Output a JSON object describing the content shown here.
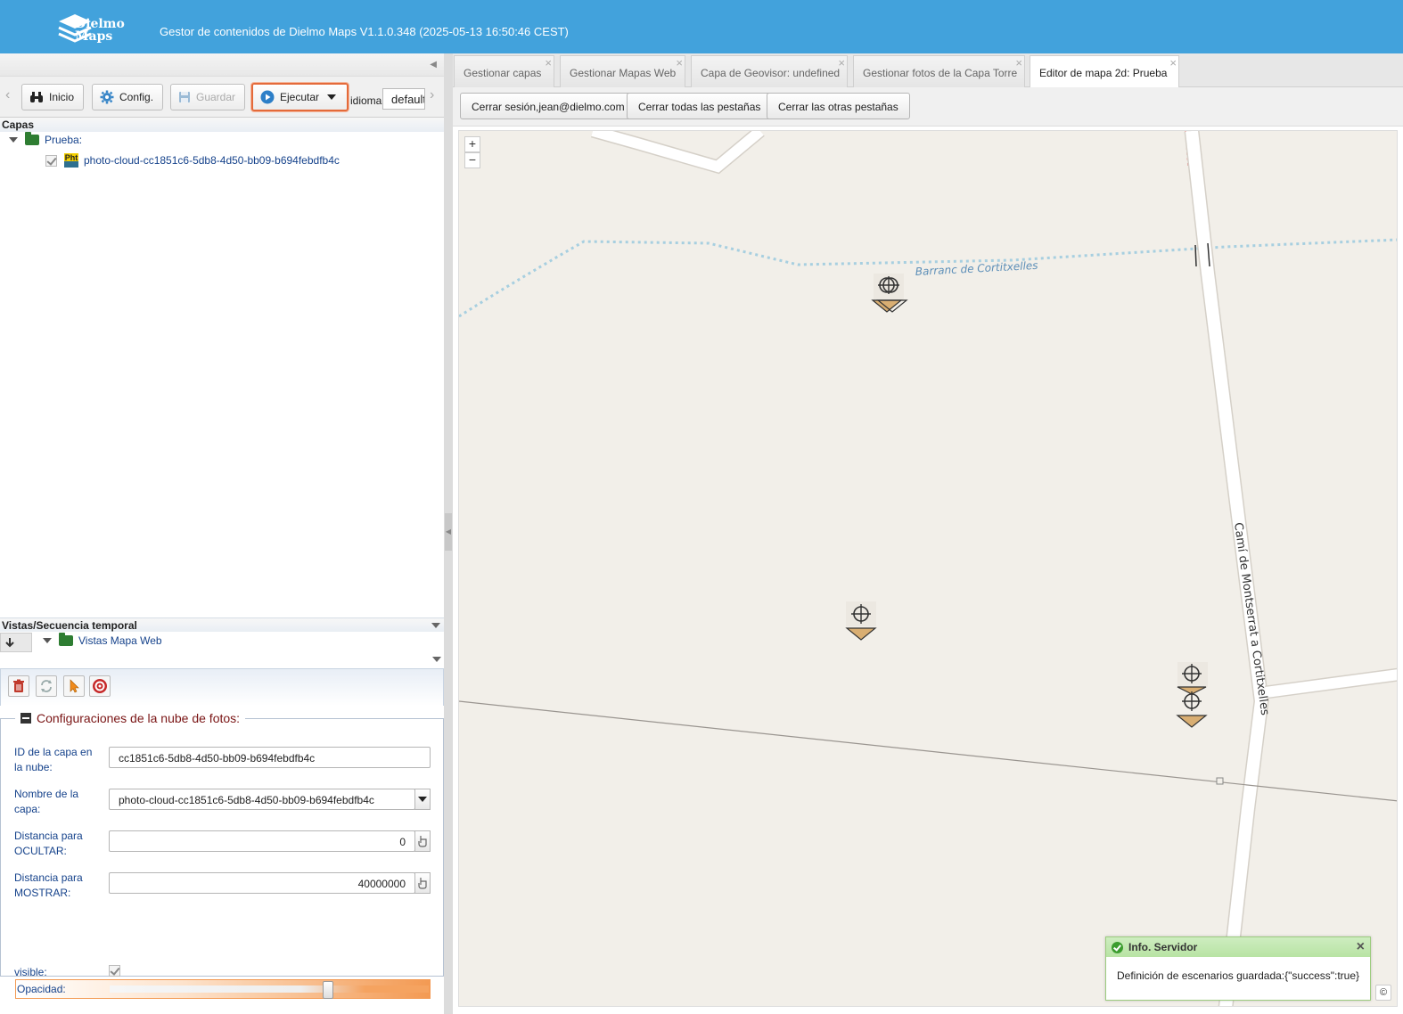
{
  "header": {
    "logo_line1": "Dielmo",
    "logo_line2": "Maps",
    "title": "Gestor de contenidos de Dielmo Maps V1.1.0.348 (2025-05-13 16:50:46 CEST)"
  },
  "toolbar": {
    "inicio": "Inicio",
    "config": "Config.",
    "guardar": "Guardar",
    "ejecutar": "Ejecutar",
    "idioma_label": "idioma:",
    "idioma_value": "default"
  },
  "layers": {
    "header": "Capas",
    "folder": "Prueba:",
    "layer_badge": "Pht",
    "layer_name": "photo-cloud-cc1851c6-5db8-4d50-bb09-b694febdfb4c"
  },
  "vistas": {
    "header": "Vistas/Secuencia temporal",
    "folder": "Vistas Mapa Web"
  },
  "config": {
    "legend": "Configuraciones de la nube de fotos:",
    "id_label": "ID de la capa en la nube:",
    "id_value": "cc1851c6-5db8-4d50-bb09-b694febdfb4c",
    "name_label": "Nombre de la capa:",
    "name_value": "photo-cloud-cc1851c6-5db8-4d50-bb09-b694febdfb4c",
    "hide_label": "Distancia para OCULTAR:",
    "hide_value": "0",
    "show_label": "Distancia para MOSTRAR:",
    "show_value": "40000000",
    "visible_label": "visible:",
    "visible_checked": true,
    "opacity_label": "Opacidad:",
    "opacity_fraction": 0.69
  },
  "tabs": [
    {
      "label": "Gestionar capas",
      "active": false
    },
    {
      "label": "Gestionar Mapas Web",
      "active": false
    },
    {
      "label": "Capa de Geovisor: undefined",
      "active": false
    },
    {
      "label": "Gestionar fotos de la Capa Torre",
      "active": false
    },
    {
      "label": "Editor de mapa 2d: Prueba",
      "active": true
    }
  ],
  "tab_actions": {
    "logout": "Cerrar sesión,jean@dielmo.com",
    "close_all": "Cerrar todas las pestañas",
    "close_others": "Cerrar las otras pestañas"
  },
  "map": {
    "zoom_in": "+",
    "zoom_out": "−",
    "label_stream": "Barranc de Cortitxelles",
    "label_road": "Camí de Montserrat a Cortitxelles",
    "copyright": "©",
    "colors": {
      "background": "#f2efe9",
      "road": "#ffffff",
      "stream": "#a7cfe0",
      "marker": "#d9ae72"
    }
  },
  "toast": {
    "title": "Info. Servidor",
    "message": "Definición de escenarios guardada:{\"success\":true}"
  },
  "colors": {
    "header": "#42a2dc",
    "highlight": "#e46a3a",
    "label": "#15428b"
  }
}
